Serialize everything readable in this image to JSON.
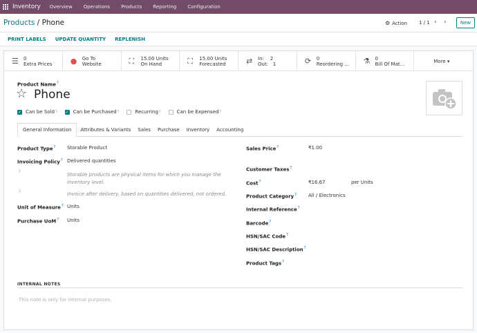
{
  "navbar": {
    "app_name": "Inventory",
    "menu": [
      "Overview",
      "Operations",
      "Products",
      "Reporting",
      "Configuration"
    ]
  },
  "control": {
    "breadcrumb_parent": "Products",
    "breadcrumb_sep": " / ",
    "breadcrumb_current": "Phone",
    "action_label": "Action",
    "pager": "1 / 1",
    "new_label": "New"
  },
  "statusbar": {
    "buttons": [
      "PRINT LABELS",
      "UPDATE QUANTITY",
      "REPLENISH"
    ]
  },
  "smart_buttons": [
    {
      "icon": "list-icon",
      "line1": "0",
      "line2": "Extra Prices"
    },
    {
      "icon": "globe-icon",
      "line1": "Go To",
      "line2": "Website"
    },
    {
      "icon": "cubes-icon",
      "line1": "15.00 Units",
      "line2": "On Hand"
    },
    {
      "icon": "cubes-icon",
      "line1": "15.00 Units",
      "line2": "Forecasted"
    },
    {
      "icon": "exchange-icon",
      "line1": "In:    2",
      "line2": "Out:   1"
    },
    {
      "icon": "refresh-icon",
      "line1": "0",
      "line2": "Reordering ..."
    },
    {
      "icon": "flask-icon",
      "line1": "0",
      "line2": "Bill Of Mat..."
    }
  ],
  "more_label": "More",
  "product": {
    "name_label": "Product Name",
    "name": "Phone",
    "checkboxes": [
      {
        "label": "Can be Sold",
        "checked": true
      },
      {
        "label": "Can be Purchased",
        "checked": true
      },
      {
        "label": "Recurring",
        "checked": false
      },
      {
        "label": "Can be Expensed",
        "checked": false
      }
    ]
  },
  "tabs": [
    "General Information",
    "Attributes & Variants",
    "Sales",
    "Purchase",
    "Inventory",
    "Accounting"
  ],
  "left_fields": {
    "product_type_label": "Product Type",
    "product_type": "Storable Product",
    "invoicing_policy_label": "Invoicing Policy",
    "invoicing_policy": "Delivered quantities",
    "help1": "Storable products are physical items for which you manage the inventory level.",
    "help2": "Invoice after delivery, based on quantities delivered, not ordered.",
    "uom_label": "Unit of Measure",
    "uom": "Units",
    "purchase_uom_label": "Purchase UoM",
    "purchase_uom": "Units"
  },
  "right_fields": {
    "sales_price_label": "Sales Price",
    "sales_price": "₹1.00",
    "customer_taxes_label": "Customer Taxes",
    "cost_label": "Cost",
    "cost": "₹16.67",
    "cost_unit": "per Units",
    "category_label": "Product Category",
    "category": "All / Electronics",
    "internal_ref_label": "Internal Reference",
    "barcode_label": "Barcode",
    "hsn_code_label": "HSN/SAC Code",
    "hsn_desc_label": "HSN/SAC Description",
    "tags_label": "Product Tags"
  },
  "notes": {
    "title": "INTERNAL NOTES",
    "placeholder": "This note is only for internal purposes."
  },
  "colors": {
    "brand": "#714b67",
    "accent": "#017e84"
  }
}
